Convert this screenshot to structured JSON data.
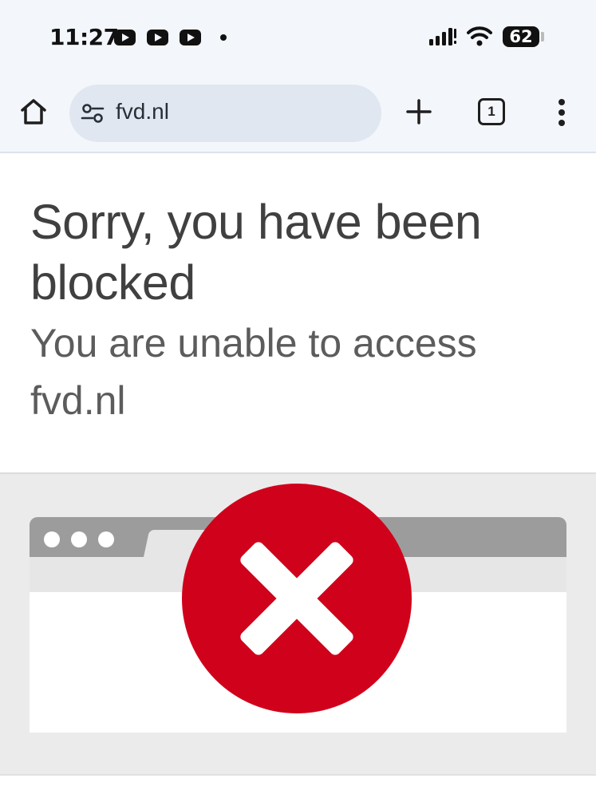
{
  "status_bar": {
    "time": "11:27",
    "notification_icons": [
      "youtube-icon",
      "youtube-icon",
      "youtube-icon"
    ],
    "battery_level": "62",
    "signal_icon": "signal-icon",
    "wifi_icon": "wifi-icon"
  },
  "toolbar": {
    "home_icon": "home-icon",
    "site_settings_icon": "tune-icon",
    "url": "fvd.nl",
    "new_tab_icon": "plus-icon",
    "tab_count": "1",
    "menu_icon": "more-vertical-icon"
  },
  "page": {
    "heading": "Sorry, you have been blocked",
    "subheading": "You are unable to access fvd.nl"
  },
  "illustration": {
    "error_icon": "red-x-circle-icon",
    "colors": {
      "error_red": "#d0021b",
      "browser_frame": "#9c9c9c",
      "band_background": "#ebebeb"
    }
  }
}
